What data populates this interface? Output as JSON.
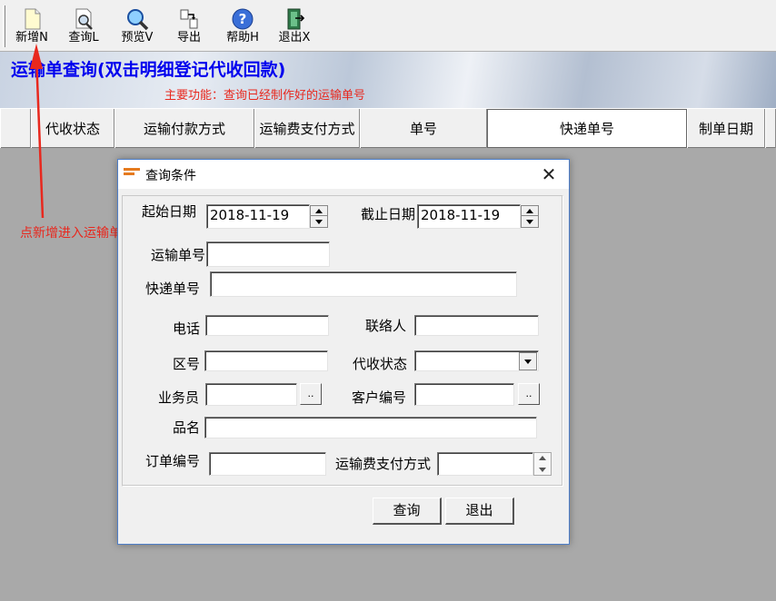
{
  "toolbar": {
    "buttons": [
      {
        "label": "新增N",
        "icon": "new-document-icon"
      },
      {
        "label": "查询L",
        "icon": "document-search-icon"
      },
      {
        "label": "预览V",
        "icon": "magnifier-icon"
      },
      {
        "label": "导出",
        "icon": "export-icon"
      },
      {
        "label": "帮助H",
        "icon": "help-icon"
      },
      {
        "label": "退出X",
        "icon": "exit-door-icon"
      }
    ]
  },
  "banner": {
    "title": "运输单查询(双击明细登记代收回款)",
    "subtitle": "主要功能：查询已经制作好的运输单号"
  },
  "grid": {
    "columns": [
      "代收状态",
      "运输付款方式",
      "运输费支付方式",
      "单号",
      "快递单号",
      "制单日期"
    ]
  },
  "annotation": "点新增进入运输单制作窗口",
  "dialog": {
    "title": "查询条件",
    "fields": {
      "start_date_label": "起始日期",
      "start_date_value": "2018-11-19",
      "end_date_label": "截止日期",
      "end_date_value": "2018-11-19",
      "waybill_label": "运输单号",
      "waybill_value": "",
      "express_label": "快递单号",
      "express_value": "",
      "phone_label": "电话",
      "phone_value": "",
      "contact_label": "联络人",
      "contact_value": "",
      "area_label": "区号",
      "area_value": "",
      "cod_status_label": "代收状态",
      "cod_status_value": "",
      "salesman_label": "业务员",
      "salesman_value": "",
      "customer_no_label": "客户编号",
      "customer_no_value": "",
      "product_label": "品名",
      "product_value": "",
      "order_no_label": "订单编号",
      "order_no_value": "",
      "freight_pay_label": "运输费支付方式",
      "freight_pay_value": ""
    },
    "browse_label": "..",
    "query_button": "查询",
    "exit_button": "退出"
  },
  "colors": {
    "title_blue": "#0000ee",
    "annotation_red": "#e8281e",
    "workspace_gray": "#a9a9a9"
  }
}
